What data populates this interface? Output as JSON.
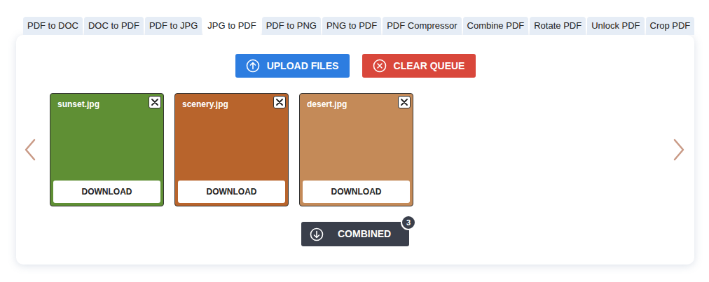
{
  "tabs": [
    {
      "label": "PDF to DOC",
      "selected": false
    },
    {
      "label": "DOC to PDF",
      "selected": false
    },
    {
      "label": "PDF to JPG",
      "selected": false
    },
    {
      "label": "JPG to PDF",
      "selected": true
    },
    {
      "label": "PDF to PNG",
      "selected": false
    },
    {
      "label": "PNG to PDF",
      "selected": false
    },
    {
      "label": "PDF Compressor",
      "selected": false
    },
    {
      "label": "Combine PDF",
      "selected": false
    },
    {
      "label": "Rotate PDF",
      "selected": false
    },
    {
      "label": "Unlock PDF",
      "selected": false
    },
    {
      "label": "Crop PDF",
      "selected": false
    }
  ],
  "toolbar": {
    "upload": "UPLOAD FILES",
    "clear": "CLEAR QUEUE"
  },
  "files": [
    {
      "name": "sunset.jpg",
      "download": "DOWNLOAD",
      "color": "#5f8f34"
    },
    {
      "name": "scenery.jpg",
      "download": "DOWNLOAD",
      "color": "#b8642c"
    },
    {
      "name": "desert.jpg",
      "download": "DOWNLOAD",
      "color": "#c48a58"
    }
  ],
  "combined": {
    "label": "COMBINED",
    "count": "3"
  }
}
